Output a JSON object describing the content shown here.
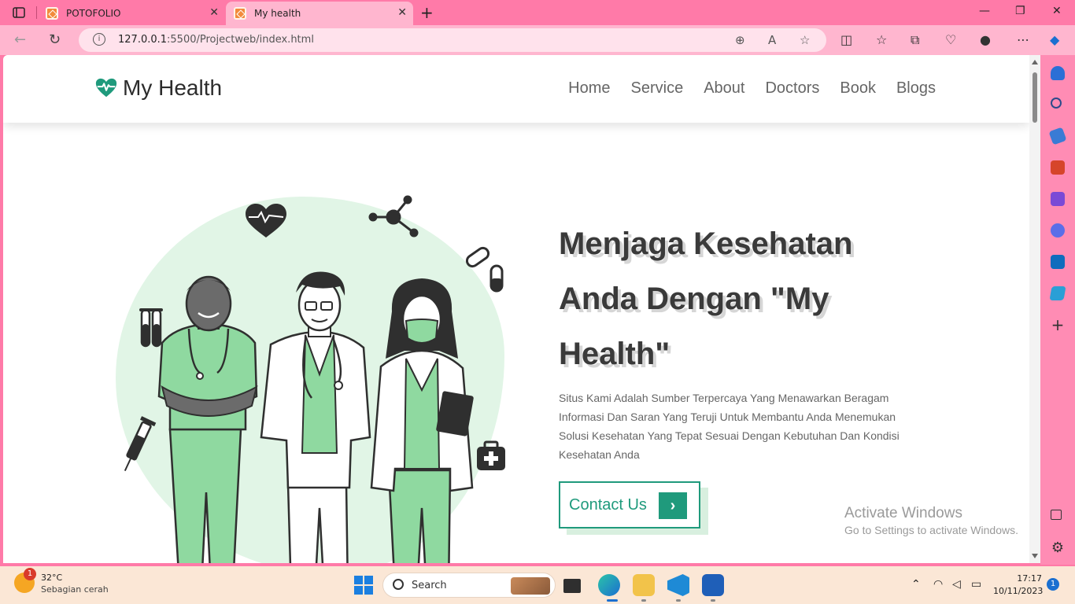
{
  "browser": {
    "tabs": [
      {
        "label": "POTOFOLIO",
        "active": false
      },
      {
        "label": "My health",
        "active": true
      }
    ],
    "url_host": "127.0.0.1",
    "url_path": ":5500/Projectweb/index.html"
  },
  "site": {
    "brand": "My Health",
    "nav": [
      "Home",
      "Service",
      "About",
      "Doctors",
      "Book",
      "Blogs"
    ],
    "headline": "Menjaga Kesehatan Anda Dengan \"My Health\"",
    "description": "Situs Kami Adalah Sumber Terpercaya Yang Menawarkan Beragam Informasi Dan Saran Yang Teruji Untuk Membantu Anda Menemukan Solusi Kesehatan Yang Tepat Sesuai Dengan Kebutuhan Dan Kondisi Kesehatan Anda",
    "cta_label": "Contact Us",
    "accent_color": "#1f9a7c"
  },
  "watermark": {
    "line1": "Activate Windows",
    "line2": "Go to Settings to activate Windows."
  },
  "taskbar": {
    "weather_temp": "32°C",
    "weather_condition": "Sebagian cerah",
    "weather_badge": "1",
    "search_label": "Search",
    "time": "17:17",
    "date": "10/11/2023",
    "notification_count": "1"
  }
}
